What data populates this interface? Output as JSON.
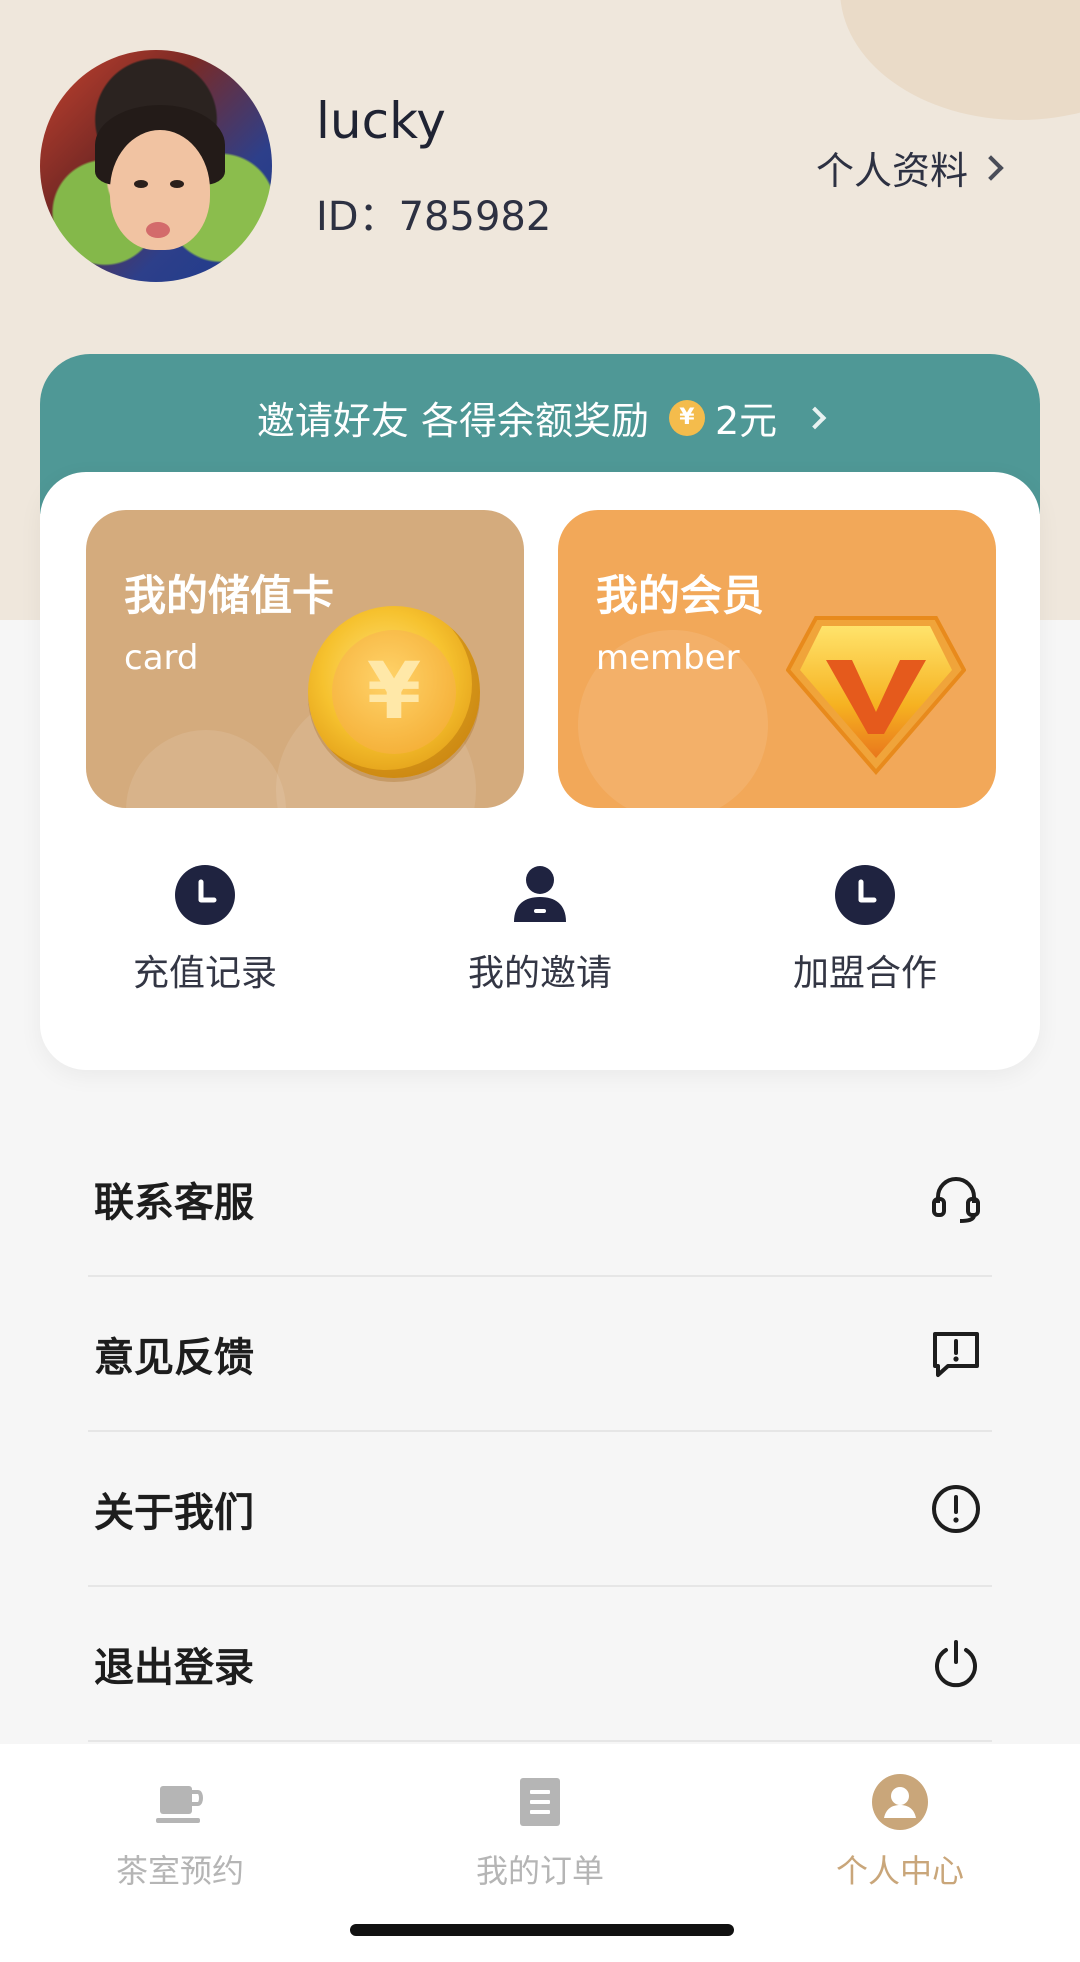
{
  "profile": {
    "username": "lucky",
    "id_text": "ID：785982",
    "profile_link": "个人资料"
  },
  "invite": {
    "text": "邀请好友 各得余额奖励",
    "coin_symbol": "¥",
    "amount": "2元"
  },
  "features": {
    "card": {
      "title": "我的储值卡",
      "subtitle": "card",
      "coin_symbol": "¥"
    },
    "member": {
      "title": "我的会员",
      "subtitle": "member"
    }
  },
  "quick_actions": [
    {
      "label": "充值记录",
      "icon": "clock-icon"
    },
    {
      "label": "我的邀请",
      "icon": "user-icon"
    },
    {
      "label": "加盟合作",
      "icon": "clock-icon"
    }
  ],
  "menu": [
    {
      "label": "联系客服",
      "icon": "headset-icon"
    },
    {
      "label": "意见反馈",
      "icon": "feedback-icon"
    },
    {
      "label": "关于我们",
      "icon": "info-icon"
    },
    {
      "label": "退出登录",
      "icon": "power-icon"
    }
  ],
  "tabs": [
    {
      "label": "茶室预约",
      "icon": "teacup-icon",
      "active": false
    },
    {
      "label": "我的订单",
      "icon": "order-icon",
      "active": false
    },
    {
      "label": "个人中心",
      "icon": "profile-icon",
      "active": true
    }
  ],
  "colors": {
    "header_bg": "#efe7dc",
    "invite_bg": "#4f9896",
    "card_bg": "#d4ab7d",
    "member_bg": "#f2a859",
    "icon_dark": "#1f2340",
    "tab_active": "#c9a67a",
    "tab_inactive": "#b5b5b5"
  }
}
